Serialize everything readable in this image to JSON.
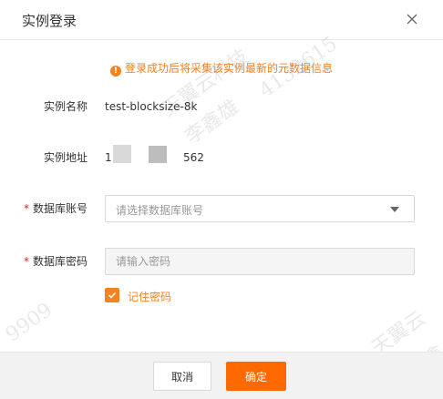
{
  "dialog": {
    "title": "实例登录",
    "close_icon": "close-icon"
  },
  "notice": {
    "icon": "warning-circle-icon",
    "text": "登录成功后将采集该实例最新的元数据信息",
    "color": "#f58220"
  },
  "form": {
    "name_label": "实例名称",
    "name_value": "test-blocksize-8k",
    "address_label": "实例地址",
    "address_prefix": "1",
    "address_suffix": "562",
    "account_label": "数据库账号",
    "account_placeholder": "请选择数据库账号",
    "password_label": "数据库密码",
    "password_placeholder": "请输入密码",
    "remember_label": "记住密码",
    "remember_checked": true,
    "required_mark": "*"
  },
  "footer": {
    "cancel_label": "取消",
    "ok_label": "确定"
  },
  "colors": {
    "accent": "#ff6a00",
    "required": "#e02020"
  },
  "watermarks": [
    "天翼云科技",
    "4132615",
    "李鑫雄",
    "天翼云",
    "李鑫",
    "9909"
  ]
}
